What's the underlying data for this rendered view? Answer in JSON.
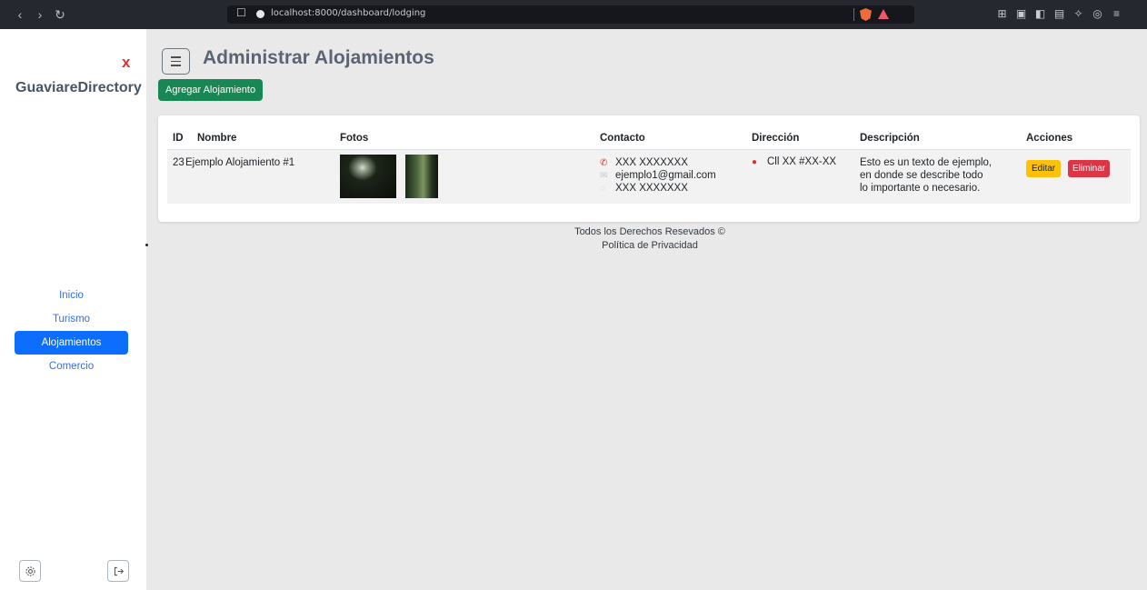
{
  "browser": {
    "url": "localhost:8000/dashboard/lodging"
  },
  "sidebar": {
    "close_label": "x",
    "brand": "GuaviareDirectory",
    "items": [
      {
        "label": "Inicio"
      },
      {
        "label": "Turismo"
      },
      {
        "label": "Alojamientos"
      },
      {
        "label": "Comercio"
      }
    ],
    "active_index": 2
  },
  "main": {
    "title": "Administrar Alojamientos",
    "add_button": "Agregar Alojamiento",
    "table": {
      "headers": [
        "ID",
        "Nombre",
        "Fotos",
        "Contacto",
        "Dirección",
        "Descripción",
        "Acciones"
      ],
      "rows": [
        {
          "id": "23",
          "name": "Ejemplo Alojamiento #1",
          "phone": "XXX XXXXXXX",
          "email": "ejemplo1@gmail.com",
          "whatsapp": "XXX XXXXXXX",
          "address": "Cll XX #XX-XX",
          "description_lines": [
            "Esto es un texto de ejemplo,",
            "en donde se describe todo",
            "lo importante o necesario."
          ],
          "edit_label": "Editar",
          "delete_label": "Eliminar"
        }
      ]
    }
  },
  "footer": {
    "rights": "Todos los Derechos Resevados ©",
    "privacy": "Política de Privacidad"
  },
  "colors": {
    "primary": "#0d6efd",
    "success": "#198754",
    "warning": "#ffc107",
    "danger": "#dc3545"
  }
}
